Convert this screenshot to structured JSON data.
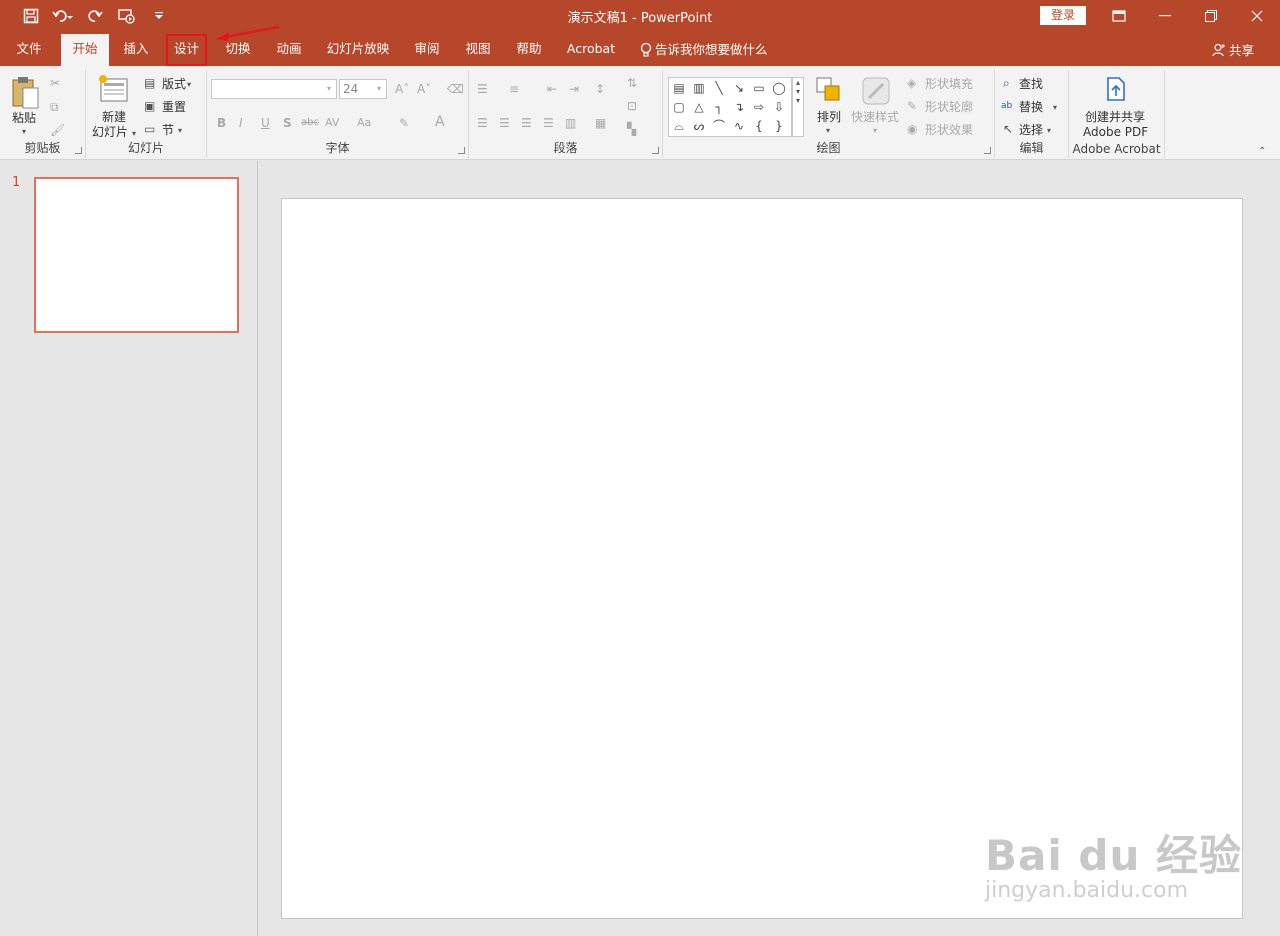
{
  "window": {
    "title": "演示文稿1  -  PowerPoint",
    "login_label": "登录",
    "minimize": "—",
    "maximize": "❐",
    "close": "✕",
    "ribbon_display": "⊡"
  },
  "qat": {
    "save": "💾",
    "undo": "↶",
    "redo": "↷",
    "slideshow": "⊚",
    "customize": "⩡"
  },
  "tabs": [
    {
      "label": "文件"
    },
    {
      "label": "开始"
    },
    {
      "label": "插入"
    },
    {
      "label": "设计"
    },
    {
      "label": "切换"
    },
    {
      "label": "动画"
    },
    {
      "label": "幻灯片放映"
    },
    {
      "label": "审阅"
    },
    {
      "label": "视图"
    },
    {
      "label": "帮助"
    },
    {
      "label": "Acrobat"
    },
    {
      "label": "告诉我你想要做什么"
    }
  ],
  "share_label": "共享",
  "ribbon": {
    "clipboard": {
      "group": "剪贴板",
      "paste": "粘贴"
    },
    "slides": {
      "group": "幻灯片",
      "new_slide_1": "新建",
      "new_slide_2": "幻灯片",
      "layout": "版式",
      "reset": "重置",
      "section": "节"
    },
    "font": {
      "group": "字体",
      "font_name": "",
      "font_size": "24",
      "bold": "B",
      "italic": "I",
      "underline": "U",
      "shadow": "S",
      "strike": "abc",
      "spacing": "AV",
      "case": "Aa",
      "color": "A"
    },
    "paragraph": {
      "group": "段落"
    },
    "drawing": {
      "group": "绘图",
      "arrange": "排列",
      "quick_styles": "快速样式",
      "shape_fill": "形状填充",
      "shape_outline": "形状轮廓",
      "shape_effects": "形状效果"
    },
    "editing": {
      "group": "编辑",
      "find": "查找",
      "replace": "替换",
      "select": "选择"
    },
    "acrobat": {
      "group": "Adobe Acrobat",
      "create_1": "创建并共享",
      "create_2": "Adobe PDF"
    }
  },
  "slides_pane": {
    "thumb_number": "1"
  },
  "watermark": {
    "line1": "Bai du 经验",
    "line2": "jingyan.baidu.com"
  },
  "colors": {
    "accent": "#b7472a",
    "highlight": "#e8161c",
    "thumb_border": "#e17055"
  }
}
